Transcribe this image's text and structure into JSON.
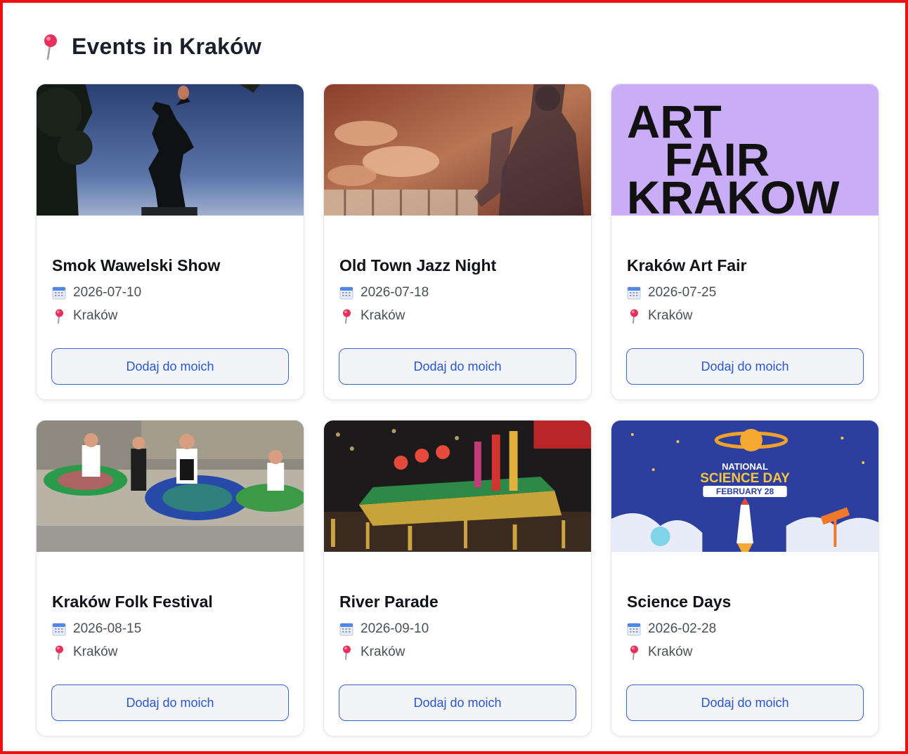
{
  "header": {
    "title": "Events in Kraków",
    "icon": "map-pin-icon"
  },
  "events": [
    {
      "title": "Smok Wawelski Show",
      "date": "2026-07-10",
      "location": "Kraków",
      "button_label": "Dodaj do moich",
      "image": "wawel-dragon-statue-photo"
    },
    {
      "title": "Old Town Jazz Night",
      "date": "2026-07-18",
      "location": "Kraków",
      "button_label": "Dodaj do moich",
      "image": "jazz-piano-saxophone-photo"
    },
    {
      "title": "Kraków Art Fair",
      "date": "2026-07-25",
      "location": "Kraków",
      "button_label": "Dodaj do moich",
      "image": "art-fair-poster",
      "image_text": [
        "ART",
        "FAIR",
        "KRAKOW"
      ]
    },
    {
      "title": "Kraków Folk Festival",
      "date": "2026-08-15",
      "location": "Kraków",
      "button_label": "Dodaj do moich",
      "image": "folk-dancers-photo"
    },
    {
      "title": "River Parade",
      "date": "2026-09-10",
      "location": "Kraków",
      "button_label": "Dodaj do moich",
      "image": "parade-float-photo"
    },
    {
      "title": "Science Days",
      "date": "2026-02-28",
      "location": "Kraków",
      "button_label": "Dodaj do moich",
      "image": "science-day-poster",
      "image_text": [
        "NATIONAL",
        "SCIENCE DAY",
        "FEBRUARY 28"
      ]
    }
  ],
  "icons": {
    "date": "calendar-icon",
    "location": "map-pin-icon"
  },
  "colors": {
    "accent": "#2a57cf",
    "button_border": "#3b63d6",
    "frame": "#ee1111",
    "art_poster_bg": "#c9adf7",
    "science_poster_bg": "#2c3f9e"
  }
}
